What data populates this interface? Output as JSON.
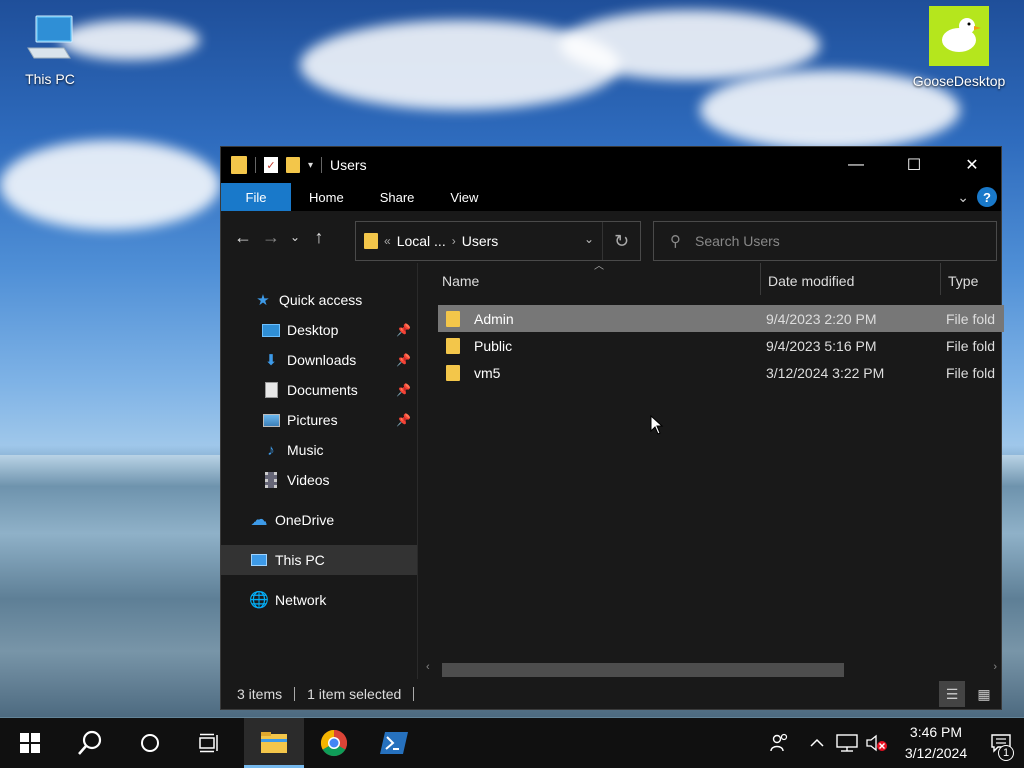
{
  "desktop": {
    "icons": [
      {
        "label": "This PC"
      },
      {
        "label": "GooseDesktop"
      }
    ]
  },
  "window": {
    "title": "Users",
    "controls": {
      "minimize": "—",
      "maximize": "☐",
      "close": "✕"
    },
    "ribbon_tabs": [
      "File",
      "Home",
      "Share",
      "View"
    ],
    "address": {
      "overflow": "«",
      "crumbs": [
        "Local ...",
        "Users"
      ]
    },
    "search": {
      "placeholder": "Search Users"
    },
    "nav": {
      "quick_access": "Quick access",
      "items": [
        {
          "label": "Desktop",
          "pinned": true
        },
        {
          "label": "Downloads",
          "pinned": true
        },
        {
          "label": "Documents",
          "pinned": true
        },
        {
          "label": "Pictures",
          "pinned": true
        },
        {
          "label": "Music",
          "pinned": false
        },
        {
          "label": "Videos",
          "pinned": false
        }
      ],
      "onedrive": "OneDrive",
      "this_pc": "This PC",
      "network": "Network"
    },
    "columns": {
      "name": "Name",
      "date": "Date modified",
      "type": "Type"
    },
    "files": [
      {
        "name": "Admin",
        "date": "9/4/2023 2:20 PM",
        "type": "File fold",
        "selected": true
      },
      {
        "name": "Public",
        "date": "9/4/2023 5:16 PM",
        "type": "File fold",
        "selected": false
      },
      {
        "name": "vm5",
        "date": "3/12/2024 3:22 PM",
        "type": "File fold",
        "selected": false
      }
    ],
    "status": {
      "count": "3 items",
      "selection": "1 item selected"
    }
  },
  "taskbar": {
    "time": "3:46 PM",
    "date": "3/12/2024",
    "notifications": "1"
  },
  "colors": {
    "accent": "#1979ca",
    "folder": "#f3c64a",
    "selection": "#777777",
    "window_bg": "#191919"
  }
}
